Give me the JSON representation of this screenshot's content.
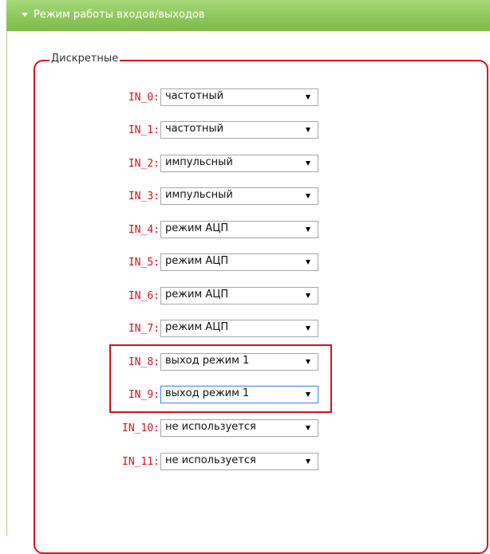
{
  "panel": {
    "title": "Режим работы входов/выходов"
  },
  "fieldset": {
    "legend": "Дискретные"
  },
  "inputs": [
    {
      "label": "IN_0:",
      "value": "частотный"
    },
    {
      "label": "IN_1:",
      "value": "частотный"
    },
    {
      "label": "IN_2:",
      "value": "импульсный"
    },
    {
      "label": "IN_3:",
      "value": "импульсный"
    },
    {
      "label": "IN_4:",
      "value": "режим АЦП"
    },
    {
      "label": "IN_5:",
      "value": "режим АЦП"
    },
    {
      "label": "IN_6:",
      "value": "режим АЦП"
    },
    {
      "label": "IN_7:",
      "value": "режим АЦП"
    },
    {
      "label": "IN_8:",
      "value": "выход режим 1"
    },
    {
      "label": "IN_9:",
      "value": "выход режим 1"
    },
    {
      "label": "IN_10:",
      "value": "не используется"
    },
    {
      "label": "IN_11:",
      "value": "не используется"
    }
  ],
  "colors": {
    "header": "#8ec75c",
    "accent_red": "#d6101c",
    "focus_blue": "#4d90fe"
  }
}
